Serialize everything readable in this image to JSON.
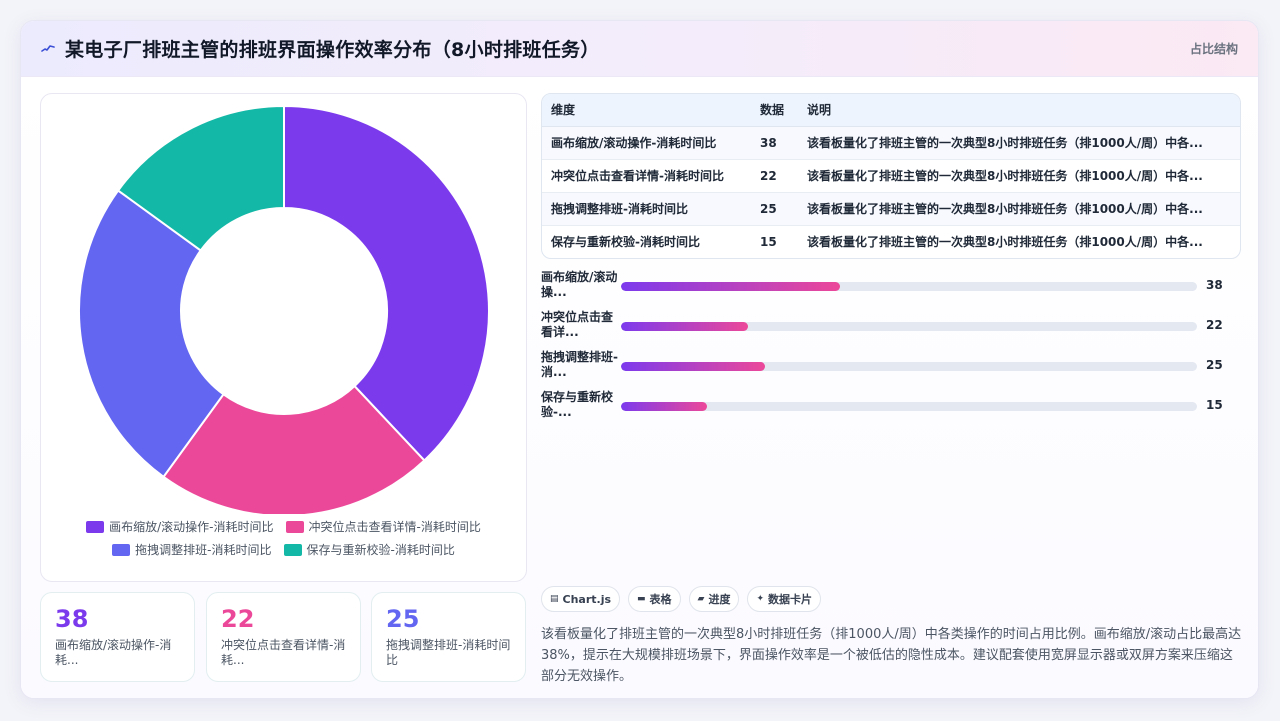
{
  "header": {
    "title": "某电子厂排班主管的排班界面操作效率分布（8小时排班任务）",
    "badge": "占比结构"
  },
  "colors": {
    "canvas": "#7c3aed",
    "conflict": "#ec4899",
    "drag": "#6366f1",
    "save": "#14b8a6"
  },
  "chart_data": {
    "type": "pie",
    "variant": "donut",
    "categories": [
      "画布缩放/滚动操作-消耗时间比",
      "冲突位点击查看详情-消耗时间比",
      "拖拽调整排班-消耗时间比",
      "保存与重新校验-消耗时间比"
    ],
    "values": [
      38,
      22,
      25,
      15
    ],
    "colors": [
      "#7c3aed",
      "#ec4899",
      "#6366f1",
      "#14b8a6"
    ],
    "legend_position": "bottom"
  },
  "table": {
    "headers": [
      "维度",
      "数据",
      "说明"
    ],
    "rows": [
      {
        "dim": "画布缩放/滚动操作-消耗时间比",
        "value": "38",
        "note": "该看板量化了排班主管的一次典型8小时排班任务（排1000人/周）中各..."
      },
      {
        "dim": "冲突位点击查看详情-消耗时间比",
        "value": "22",
        "note": "该看板量化了排班主管的一次典型8小时排班任务（排1000人/周）中各..."
      },
      {
        "dim": "拖拽调整排班-消耗时间比",
        "value": "25",
        "note": "该看板量化了排班主管的一次典型8小时排班任务（排1000人/周）中各..."
      },
      {
        "dim": "保存与重新校验-消耗时间比",
        "value": "15",
        "note": "该看板量化了排班主管的一次典型8小时排班任务（排1000人/周）中各..."
      }
    ]
  },
  "bars": [
    {
      "label": "画布缩放/滚动操...",
      "value": 38,
      "value_text": "38"
    },
    {
      "label": "冲突位点击查看详...",
      "value": 22,
      "value_text": "22"
    },
    {
      "label": "拖拽调整排班-消...",
      "value": 25,
      "value_text": "25"
    },
    {
      "label": "保存与重新校验-...",
      "value": 15,
      "value_text": "15"
    }
  ],
  "bars_max": 100,
  "stats": [
    {
      "value": "38",
      "label": "画布缩放/滚动操作-消耗..."
    },
    {
      "value": "22",
      "label": "冲突位点击查看详情-消耗..."
    },
    {
      "value": "25",
      "label": "拖拽调整排班-消耗时间比"
    }
  ],
  "tags": [
    {
      "icon": "chart-icon",
      "label": "Chart.js"
    },
    {
      "icon": "table-icon",
      "label": "表格"
    },
    {
      "icon": "progress-icon",
      "label": "进度"
    },
    {
      "icon": "sparkle-icon",
      "label": "数据卡片"
    }
  ],
  "description": "该看板量化了排班主管的一次典型8小时排班任务（排1000人/周）中各类操作的时间占用比例。画布缩放/滚动占比最高达38%，提示在大规模排班场景下，界面操作效率是一个被低估的隐性成本。建议配套使用宽屏显示器或双屏方案来压缩这部分无效操作。"
}
